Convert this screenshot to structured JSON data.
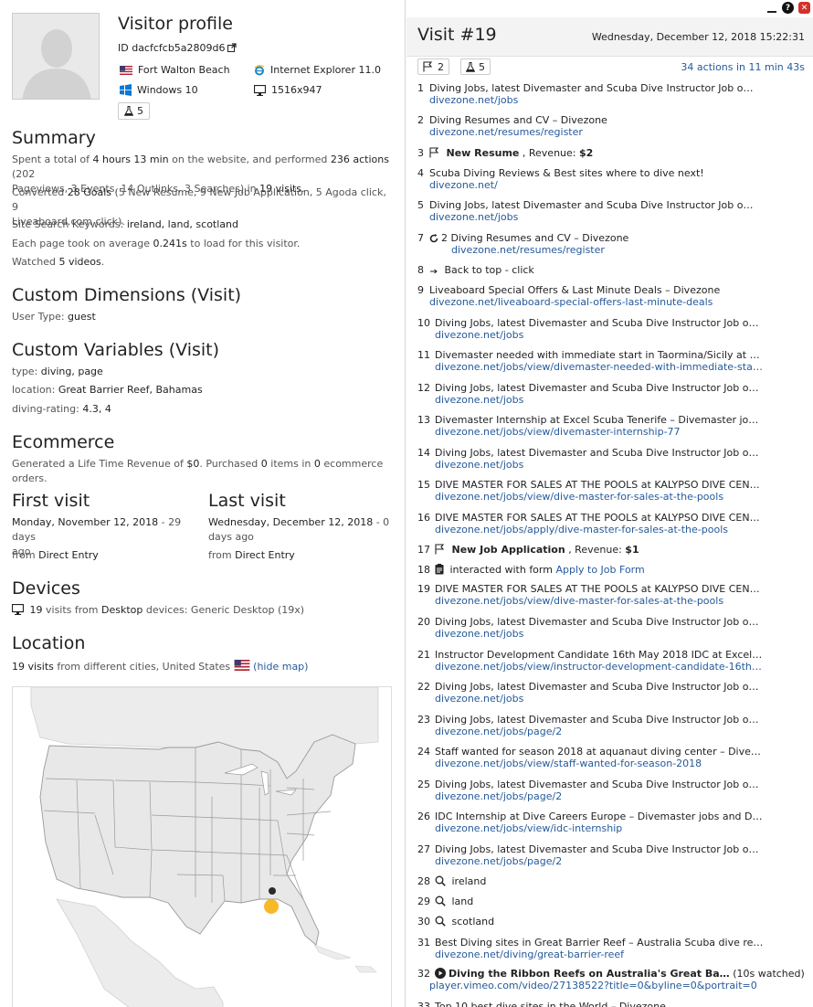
{
  "profile": {
    "title": "Visitor profile",
    "id": "ID dacfcfcb5a2809d6",
    "city": "Fort Walton Beach",
    "browser": "Internet Explorer 11.0",
    "os": "Windows 10",
    "resolution": "1516x947",
    "experiments": "5"
  },
  "summary": {
    "title": "Summary",
    "l1a": "Spent a total of ",
    "l1b": "4 hours 13 min",
    "l1c": " on the website, and performed ",
    "l1d": "236 actions",
    "l1e": " (202",
    "l2a": "Pageviews, 3 Events, 14 Outlinks, 3 Searches) in ",
    "l2b": "19 visits",
    "goals_a": "Converted ",
    "goals_b": "28 Goals",
    "goals_c": " (5 New Resume, 9 New Job Application, 5 Agoda click, 9",
    "goals_d": "Liveaboard.com click).",
    "kw_a": "Site Search Keywords: ",
    "kw_b": "ireland, land, scotland",
    "load_a": "Each page took on average ",
    "load_b": "0.241s",
    "load_c": " to load for this visitor.",
    "vid_a": "Watched ",
    "vid_b": "5 videos",
    "vid_c": "."
  },
  "custom_dims": {
    "title": "Custom Dimensions (Visit)",
    "label": "User Type: ",
    "value": "guest"
  },
  "custom_vars": {
    "title": "Custom Variables (Visit)",
    "r1l": "type: ",
    "r1v": "diving, page",
    "r2l": "location: ",
    "r2v": "Great Barrier Reef, Bahamas",
    "r3l": "diving-rating: ",
    "r3v": "4.3, 4"
  },
  "ecommerce": {
    "title": "Ecommerce",
    "a": "Generated a Life Time Revenue of ",
    "b": "$0",
    "c": ". Purchased ",
    "d": "0",
    "e": " items in ",
    "f": "0",
    "g": " ecommerce orders."
  },
  "first_visit": {
    "title": "First visit",
    "date": "Monday, November 12, 2018",
    "ago_a": " - 29 days",
    "ago_b": "ago",
    "from_a": "from ",
    "from_b": "Direct Entry"
  },
  "last_visit": {
    "title": "Last visit",
    "date": "Wednesday, December 12, 2018",
    "ago_a": " - 0",
    "ago_b": "days ago",
    "from_a": "from ",
    "from_b": "Direct Entry"
  },
  "devices": {
    "title": "Devices",
    "a": "19",
    "b": " visits from ",
    "c": "Desktop",
    "d": " devices: Generic Desktop (19x)"
  },
  "location": {
    "title": "Location",
    "a": "19 visits",
    "b": " from different cities, United States ",
    "hide": "(hide map)"
  },
  "visit": {
    "title": "Visit #19",
    "date": "Wednesday, December 12, 2018 15:22:31",
    "goals_count": "2",
    "exp_count": "5",
    "summary": "34 actions in 11 min 43s"
  },
  "actions": [
    {
      "n": "1",
      "t": "Diving Jobs, latest Divemaster and Scuba Dive Instructor Job offers!",
      "u": "divezone.net/jobs"
    },
    {
      "n": "2",
      "t": "Diving Resumes and CV – Divezone",
      "u": "divezone.net/resumes/register"
    },
    {
      "n": "3",
      "goal": "New Resume",
      "rev_label": ", Revenue: ",
      "rev": "$2"
    },
    {
      "n": "4",
      "t": "Scuba Diving Reviews & Best sites where to dive next!",
      "u": "divezone.net/"
    },
    {
      "n": "5",
      "t": "Diving Jobs, latest Divemaster and Scuba Dive Instructor Job offers!",
      "u": "divezone.net/jobs"
    },
    {
      "n": "7",
      "reload": "2",
      "t": "Diving Resumes and CV – Divezone",
      "u": "divezone.net/resumes/register"
    },
    {
      "n": "8",
      "event": "Back to top - click"
    },
    {
      "n": "9",
      "t": "Liveaboard Special Offers & Last Minute Deals – Divezone",
      "u": "divezone.net/liveaboard-special-offers-last-minute-deals"
    },
    {
      "n": "10",
      "t": "Diving Jobs, latest Divemaster and Scuba Dive Instructor Job offers!",
      "u": "divezone.net/jobs"
    },
    {
      "n": "11",
      "t": "Divemaster needed with immediate start in Taormina/Sicily at Se…",
      "u": "divezone.net/jobs/view/divemaster-needed-with-immediate-start…"
    },
    {
      "n": "12",
      "t": "Diving Jobs, latest Divemaster and Scuba Dive Instructor Job offers!",
      "u": "divezone.net/jobs"
    },
    {
      "n": "13",
      "t": "Divemaster Internship at Excel Scuba Tenerife – Divemaster jobs …",
      "u": "divezone.net/jobs/view/divemaster-internship-77"
    },
    {
      "n": "14",
      "t": "Diving Jobs, latest Divemaster and Scuba Dive Instructor Job offers!",
      "u": "divezone.net/jobs"
    },
    {
      "n": "15",
      "t": "DIVE MASTER FOR SALES AT THE POOLS at KALYPSO DIVE CENTE…",
      "u": "divezone.net/jobs/view/dive-master-for-sales-at-the-pools"
    },
    {
      "n": "16",
      "t": "DIVE MASTER FOR SALES AT THE POOLS at KALYPSO DIVE CENTE…",
      "u": "divezone.net/jobs/apply/dive-master-for-sales-at-the-pools"
    },
    {
      "n": "17",
      "goal": "New Job Application",
      "rev_label": ", Revenue: ",
      "rev": "$1"
    },
    {
      "n": "18",
      "form_a": "interacted with form ",
      "form_b": "Apply to Job Form"
    },
    {
      "n": "19",
      "t": "DIVE MASTER FOR SALES AT THE POOLS at KALYPSO DIVE CENTE…",
      "u": "divezone.net/jobs/view/dive-master-for-sales-at-the-pools"
    },
    {
      "n": "20",
      "t": "Diving Jobs, latest Divemaster and Scuba Dive Instructor Job offers!",
      "u": "divezone.net/jobs"
    },
    {
      "n": "21",
      "t": "Instructor Development Candidate 16th May 2018 IDC at Excel Sc…",
      "u": "divezone.net/jobs/view/instructor-development-candidate-16th-m…"
    },
    {
      "n": "22",
      "t": "Diving Jobs, latest Divemaster and Scuba Dive Instructor Job offers!",
      "u": "divezone.net/jobs"
    },
    {
      "n": "23",
      "t": "Diving Jobs, latest Divemaster and Scuba Dive Instructor Job offers!",
      "u": "divezone.net/jobs/page/2"
    },
    {
      "n": "24",
      "t": "Staff wanted for season 2018 at aquanaut diving center – Divema…",
      "u": "divezone.net/jobs/view/staff-wanted-for-season-2018"
    },
    {
      "n": "25",
      "t": "Diving Jobs, latest Divemaster and Scuba Dive Instructor Job offers!",
      "u": "divezone.net/jobs/page/2"
    },
    {
      "n": "26",
      "t": "IDC Internship at Dive Careers Europe – Divemaster jobs and Div…",
      "u": "divezone.net/jobs/view/idc-internship"
    },
    {
      "n": "27",
      "t": "Diving Jobs, latest Divemaster and Scuba Dive Instructor Job offers!",
      "u": "divezone.net/jobs/page/2"
    },
    {
      "n": "28",
      "search": "ireland"
    },
    {
      "n": "29",
      "search": "land"
    },
    {
      "n": "30",
      "search": "scotland"
    },
    {
      "n": "31",
      "t": "Best Diving sites in Great Barrier Reef – Australia Scuba dive revi…",
      "u": "divezone.net/diving/great-barrier-reef"
    },
    {
      "n": "32",
      "video": "Diving the Ribbon Reefs on Australia's Great Ba…",
      "watched": "(10s watched)",
      "u": "player.vimeo.com/video/27138522?title=0&byline=0&portrait=0"
    },
    {
      "n": "33",
      "t": "Top 10 best dive sites in the World – Divezone"
    }
  ]
}
